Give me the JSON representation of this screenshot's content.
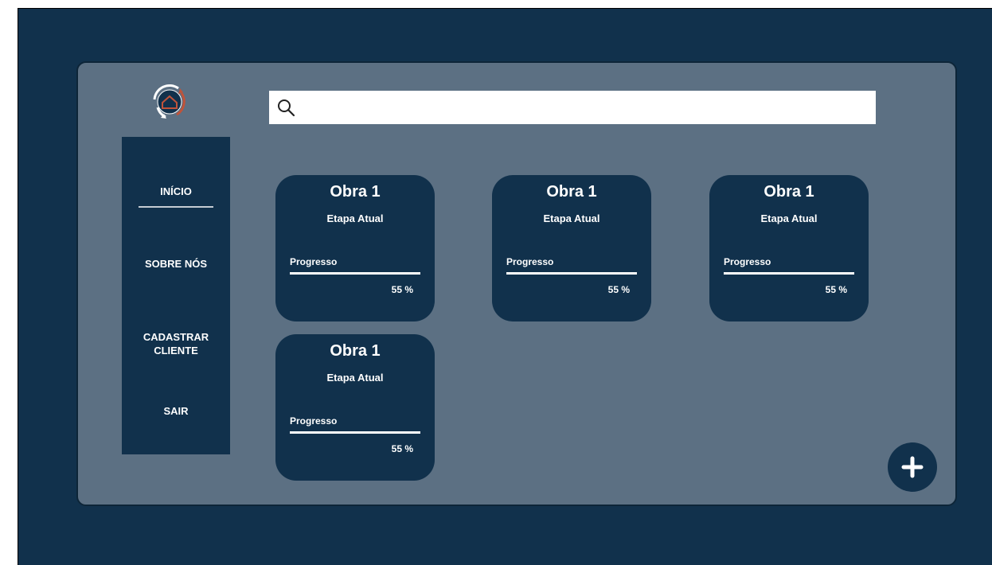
{
  "search": {
    "placeholder": "",
    "value": ""
  },
  "sidebar": {
    "items": [
      {
        "label": "INÍCIO",
        "active": true
      },
      {
        "label": "SOBRE NÓS",
        "active": false
      },
      {
        "label": "CADASTRAR CLIENTE",
        "active": false
      },
      {
        "label": "SAIR",
        "active": false
      }
    ]
  },
  "cards": [
    {
      "title": "Obra 1",
      "stage": "Etapa Atual",
      "progress_label": "Progresso",
      "progress_text": "55 %",
      "progress": 1.0
    },
    {
      "title": "Obra 1",
      "stage": "Etapa Atual",
      "progress_label": "Progresso",
      "progress_text": "55 %",
      "progress": 1.0
    },
    {
      "title": "Obra 1",
      "stage": "Etapa Atual",
      "progress_label": "Progresso",
      "progress_text": "55 %",
      "progress": 1.0
    },
    {
      "title": "Obra 1",
      "stage": "Etapa Atual",
      "progress_label": "Progresso",
      "progress_text": "55 %",
      "progress": 1.0
    }
  ],
  "icons": {
    "search": "search-icon",
    "add": "plus-icon",
    "logo": "company-logo-icon"
  },
  "colors": {
    "background": "#11314c",
    "panel": "#5c7083",
    "card": "#11314c",
    "logo_accent": "#c0533a"
  }
}
